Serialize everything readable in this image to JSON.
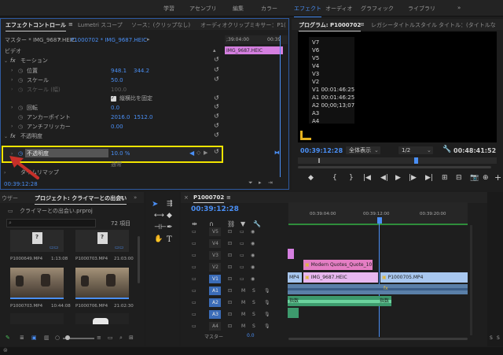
{
  "topbar": {
    "workspaces": [
      "学習",
      "アセンブリ",
      "編集",
      "カラー",
      "エフェクト",
      "オーディオ",
      "グラフィック",
      "ライブラリ"
    ],
    "active": "エフェクト",
    "more": "»"
  },
  "effect_controls": {
    "tabs": [
      "エフェクトコントロール",
      "Lumetri スコープ",
      "ソース：(クリップなし)",
      "オーディオクリップミキサー：P1("
    ],
    "tab_menu": "≡",
    "master_label": "マスター * IMG_9687.HEIC",
    "clip_label": "P1000702 * IMG_9687.HEIC",
    "ruler_time_left": ";39:04:00",
    "ruler_time_right": "00:39",
    "clip_bar_label": "IMG_9687.HEIC",
    "video_section": "ビデオ",
    "motion": "モーション",
    "position_label": "位置",
    "position_x": "948.1",
    "position_y": "344.2",
    "scale_label": "スケール",
    "scale_value": "50.0",
    "scale_width_label": "スケール (幅)",
    "scale_width_value": "100.0",
    "uniform_scale_label": "縦横比を固定",
    "rotation_label": "回転",
    "rotation_value": "0.0",
    "anchor_label": "アンカーポイント",
    "anchor_x": "2016.0",
    "anchor_y": "1512.0",
    "antiflicker_label": "アンチフリッカー",
    "antiflicker_value": "0.00",
    "opacity_section": "不透明度",
    "opacity_label": "不透明度",
    "opacity_value": "10.0 %",
    "opacity_secondary": "通常",
    "time_remap_label": "タイムリマップ",
    "timecode": "00:39:12:28",
    "fx_label": "fx"
  },
  "program": {
    "tabs": [
      "プログラム: P1000702",
      "レガシータイトルスタイル",
      "タイトル：(タイトルな"
    ],
    "overlay_lines": [
      "V7",
      "V6",
      "V5",
      "V4",
      "V3",
      "V2",
      "V1 00:01:46:25",
      "A1 00:01:46:25",
      "A2 00;00;13;07",
      "A3",
      "A4"
    ],
    "timecode_left": "00:39:12:28",
    "fit_label": "全体表示",
    "resolution_label": "1/2",
    "timecode_right": "00:48:41:52",
    "controls": [
      "◆",
      "{",
      "}",
      "|◀",
      "◀|",
      "▶",
      "|▶",
      "▶|",
      "⊞",
      "⊟",
      "📷",
      "⊕",
      "+"
    ]
  },
  "project": {
    "tabs": [
      "ウザー",
      "プロジェクト: クライマーとの出会い",
      "≡",
      "»"
    ],
    "project_file": "クライマーとの出会い.prproj",
    "search_placeholder": "",
    "item_count": "72 項目",
    "items": [
      {
        "name": "P1000649.MP4",
        "duration": "1:13:08",
        "kind": "file"
      },
      {
        "name": "P1000703.MP4",
        "duration": "21:03:00",
        "kind": "file"
      },
      {
        "name": "P1000703.MP4",
        "duration": "10:44:08",
        "kind": "video"
      },
      {
        "name": "P1000706.MP4",
        "duration": "21:02:30",
        "kind": "video"
      }
    ]
  },
  "timeline": {
    "tab_close": "×",
    "sequence_name": "P1000702",
    "menu": "≡",
    "timecode": "00:39:12:28",
    "ruler_labels": [
      "00:39:04:00",
      "00:39:12:00",
      "00:39:20:00"
    ],
    "video_tracks": [
      "V5",
      "V4",
      "V3",
      "V2",
      "V1"
    ],
    "audio_tracks": [
      "A1",
      "A2",
      "A3",
      "A4"
    ],
    "master_label": "マスター",
    "master_value": "0.0",
    "track_toggles": {
      "m": "M",
      "s": "S"
    },
    "clips": {
      "v2": "Modern Quotes_Quote_10",
      "v1_mp4": "MP4",
      "v1_heic": "IMG_9687.HEIC",
      "v1_right": "P1000705.MP4",
      "a1_fx": "fx",
      "a2_left": "指数",
      "a2_right": "指数"
    },
    "level_labels": [
      "S",
      "S"
    ]
  },
  "colors": {
    "accent": "#4a8ff5",
    "highlight": "#f1e400",
    "arrow": "#c7302a",
    "video_clip": "#f2a6ec",
    "heic_clip": "#e8b7ef",
    "audio_clip": "#3d9a6d",
    "title_clip": "#e57ec4"
  }
}
